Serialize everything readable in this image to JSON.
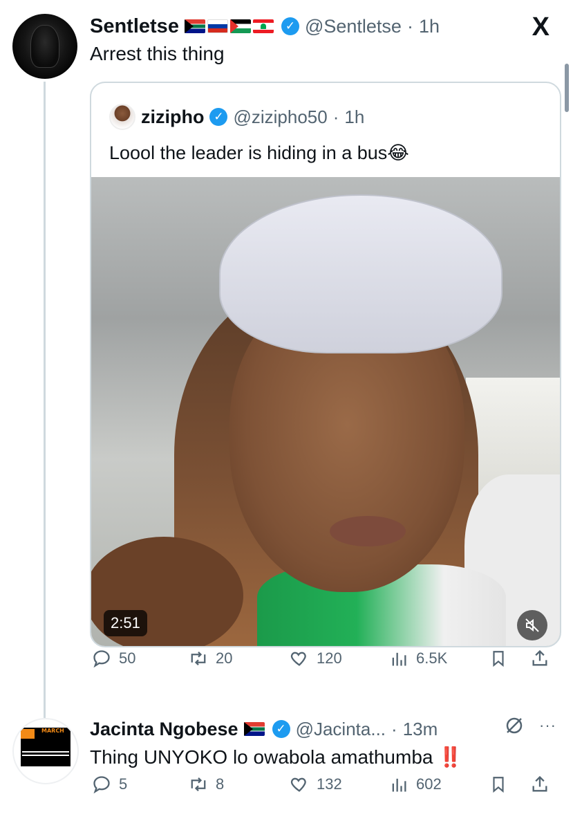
{
  "post": {
    "name": "Sentletse",
    "flags": [
      "south-africa-flag",
      "russia-flag",
      "palestine-flag",
      "lebanon-flag"
    ],
    "handle": "@Sentletse",
    "time": "1h",
    "text": "Arrest this thing"
  },
  "quote": {
    "name": "zizipho",
    "handle": "@zizipho50",
    "time": "1h",
    "text": "Loool the leader is hiding in a bus😂",
    "video_duration": "2:51"
  },
  "post_actions": {
    "replies": "50",
    "reposts": "20",
    "likes": "120",
    "views": "6.5K"
  },
  "reply": {
    "name": "Jacinta Ngobese",
    "flags": [
      "south-africa-flag"
    ],
    "handle": "@Jacinta...",
    "time": "13m",
    "text": "Thing UNYOKO lo owabola amathumba",
    "emphasis": "‼️",
    "avatar_text": "MARCH"
  },
  "reply_actions": {
    "replies": "5",
    "reposts": "8",
    "likes": "132",
    "views": "602"
  },
  "icons": {
    "platform": "X",
    "separator": "·",
    "verified": "✓",
    "more": "···"
  },
  "colors": {
    "verified": "#1d9bf0",
    "muted_text": "#536471",
    "thread_line": "#cfd9de"
  }
}
